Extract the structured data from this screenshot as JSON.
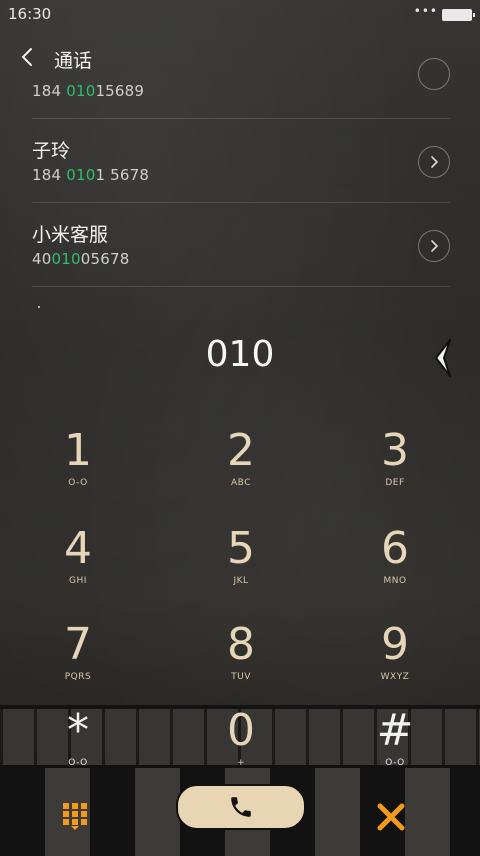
{
  "status_bar": {
    "time": "16:30",
    "dots": "•••"
  },
  "header": {
    "title": "通话"
  },
  "contacts": [
    {
      "name": "",
      "number_parts": [
        "184 ",
        "010",
        "15689"
      ]
    },
    {
      "name": "子玲",
      "number_parts": [
        "184 ",
        "010",
        "1 5678"
      ]
    },
    {
      "name": "小米客服",
      "number_parts": [
        "40",
        "010",
        "05678"
      ]
    }
  ],
  "dial": {
    "entered": "010"
  },
  "keypad": [
    {
      "digit": "1",
      "letters": "O-O"
    },
    {
      "digit": "2",
      "letters": "ABC"
    },
    {
      "digit": "3",
      "letters": "DEF"
    },
    {
      "digit": "4",
      "letters": "GHI"
    },
    {
      "digit": "5",
      "letters": "JKL"
    },
    {
      "digit": "6",
      "letters": "MNO"
    },
    {
      "digit": "7",
      "letters": "PQRS"
    },
    {
      "digit": "8",
      "letters": "TUV"
    },
    {
      "digit": "9",
      "letters": "WXYZ"
    },
    {
      "digit": "*",
      "letters": "O-O"
    },
    {
      "digit": "0",
      "letters": "+"
    },
    {
      "digit": "#",
      "letters": "O-O"
    }
  ],
  "colors": {
    "highlight": "#2fbf6b",
    "key_text": "#e6d5b8",
    "accent_orange": "#f39a1b",
    "call_button": "#e8d5b3"
  },
  "icons": {
    "back": "chevron-left-icon",
    "row_action": "chevron-right-icon",
    "collapse": "chevron-left-outline-icon",
    "keypad_toggle": "grid-icon",
    "call": "phone-icon",
    "delete": "close-icon"
  }
}
